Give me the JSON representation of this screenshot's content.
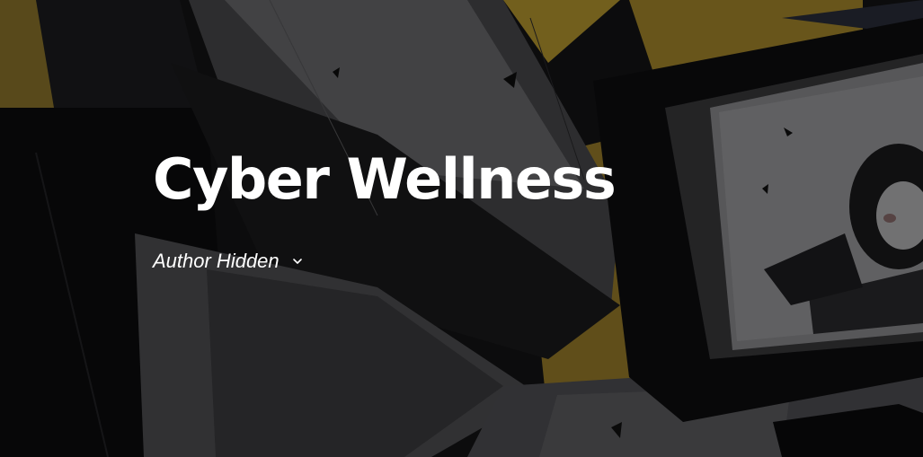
{
  "post": {
    "title": "Cyber Wellness",
    "author_label": "Author Hidden"
  },
  "icons": {
    "author_toggle": "chevron-down-icon"
  },
  "colors": {
    "title_text": "#ffffff",
    "accent_yellow": "#b8982e",
    "background_dark": "#111113"
  }
}
